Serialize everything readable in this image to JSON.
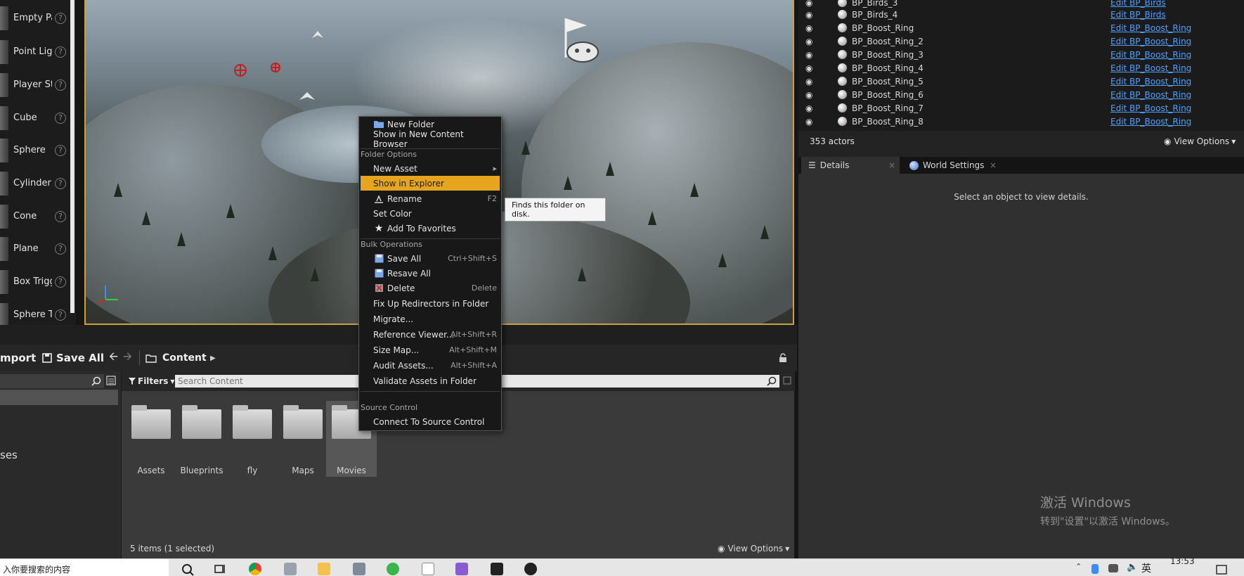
{
  "place_actors": {
    "items": [
      {
        "label": "Empty Pa"
      },
      {
        "label": "Point Ligl"
      },
      {
        "label": "Player St"
      },
      {
        "label": "Cube"
      },
      {
        "label": "Sphere"
      },
      {
        "label": "Cylinder"
      },
      {
        "label": "Cone"
      },
      {
        "label": "Plane"
      },
      {
        "label": "Box Trigg"
      },
      {
        "label": "Sphere T"
      }
    ],
    "help_glyph": "?"
  },
  "content_browser": {
    "toolbar": {
      "import_label": "mport",
      "save_all_label": "Save All",
      "back_glyph": "🡨",
      "forward_glyph": "🡪",
      "path_root": "Content",
      "path_arrow": "▶"
    },
    "left_fragment": "ses",
    "filters_label": "Filters",
    "search_placeholder": "Search Content",
    "folders": [
      {
        "name": "Assets"
      },
      {
        "name": "Blueprints"
      },
      {
        "name": "fly"
      },
      {
        "name": "Maps"
      },
      {
        "name": "Movies"
      }
    ],
    "status": "5 items (1 selected)",
    "view_options": "View Options"
  },
  "context_menu": {
    "items_top": [
      {
        "label": "New Folder",
        "icon": "new-folder-icon"
      },
      {
        "label": "Show in New Content Browser"
      }
    ],
    "section_folder_options": "Folder Options",
    "folder_options": [
      {
        "label": "New Asset",
        "submenu": "▸"
      },
      {
        "label": "Show in Explorer",
        "highlighted": true
      },
      {
        "label": "Rename",
        "icon": "rename-icon",
        "shortcut": "F2"
      },
      {
        "label": "Set Color"
      },
      {
        "label": "Add To Favorites",
        "icon": "star-icon"
      }
    ],
    "section_bulk": "Bulk Operations",
    "bulk": [
      {
        "label": "Save All",
        "icon": "save-icon",
        "shortcut": "Ctrl+Shift+S"
      },
      {
        "label": "Resave All",
        "icon": "resave-icon"
      },
      {
        "label": "Delete",
        "icon": "delete-icon",
        "shortcut": "Delete"
      },
      {
        "label": "Fix Up Redirectors in Folder"
      },
      {
        "label": "Migrate..."
      },
      {
        "label": "Reference Viewer...",
        "shortcut": "Alt+Shift+R"
      },
      {
        "label": "Size Map...",
        "shortcut": "Alt+Shift+M"
      },
      {
        "label": "Audit Assets...",
        "shortcut": "Alt+Shift+A"
      },
      {
        "label": "Validate Assets in Folder"
      }
    ],
    "section_source": "Source Control",
    "source": [
      {
        "label": "Connect To Source Control"
      }
    ],
    "tooltip": "Finds this folder on disk."
  },
  "outliner": {
    "rows": [
      {
        "name": "BP_Birds_3",
        "edit": "Edit BP_Birds"
      },
      {
        "name": "BP_Birds_4",
        "edit": "Edit BP_Birds"
      },
      {
        "name": "BP_Boost_Ring",
        "edit": "Edit BP_Boost_Ring"
      },
      {
        "name": "BP_Boost_Ring_2",
        "edit": "Edit BP_Boost_Ring"
      },
      {
        "name": "BP_Boost_Ring_3",
        "edit": "Edit BP_Boost_Ring"
      },
      {
        "name": "BP_Boost_Ring_4",
        "edit": "Edit BP_Boost_Ring"
      },
      {
        "name": "BP_Boost_Ring_5",
        "edit": "Edit BP_Boost_Ring"
      },
      {
        "name": "BP_Boost_Ring_6",
        "edit": "Edit BP_Boost_Ring"
      },
      {
        "name": "BP_Boost_Ring_7",
        "edit": "Edit BP_Boost_Ring"
      },
      {
        "name": "BP_Boost_Ring_8",
        "edit": "Edit BP_Boost_Ring"
      }
    ],
    "actor_count": "353 actors",
    "view_options": "View Options"
  },
  "details": {
    "tabs": [
      {
        "label": "Details"
      },
      {
        "label": "World Settings"
      }
    ],
    "close_glyph": "×",
    "empty_message": "Select an object to view details."
  },
  "taskbar": {
    "search_text": "入你要搜索的内容",
    "ime": "英",
    "time": "13:53"
  },
  "watermark": {
    "line1": "激活 Windows",
    "line2": "转到\"设置\"以激活 Windows。"
  },
  "colors": {
    "accent": "#e6a51c",
    "link": "#4ea0ff",
    "viewport_border": "#c9a240"
  }
}
